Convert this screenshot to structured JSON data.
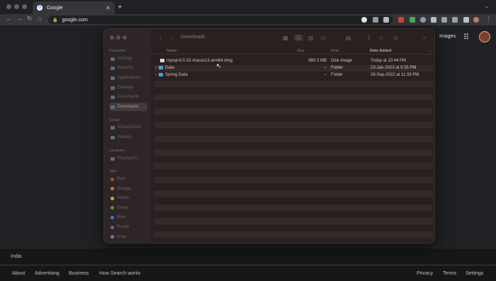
{
  "browser": {
    "tab_title": "Google",
    "tab_close": "✕",
    "new_tab": "+",
    "tab_menu": "⌄",
    "url": "google.com",
    "nav_back": "←",
    "nav_forward": "→",
    "nav_reload": "↻",
    "nav_home": "⌂",
    "lock": "🔒",
    "menu": "⋮"
  },
  "google": {
    "images_link": "Images",
    "apps_icon": "⋮⋮⋮",
    "country": "India",
    "footer_left": [
      "About",
      "Advertising",
      "Business",
      "How Search works"
    ],
    "footer_right": [
      "Privacy",
      "Terms",
      "Settings"
    ]
  },
  "finder": {
    "title": "Downloads",
    "back": "‹",
    "forward": "›",
    "sidebar": {
      "favourites_header": "Favourites",
      "favourites": [
        "AirDrop",
        "Recents",
        "Applications",
        "Desktop",
        "Documents",
        "Downloads"
      ],
      "icloud_header": "iCloud",
      "icloud": [
        "iCloud Drive",
        "Shared"
      ],
      "locations_header": "Locations",
      "locations": [
        "Prashant's..."
      ],
      "tags_header": "Tags",
      "tags": [
        {
          "label": "Red",
          "color": "#b9443e"
        },
        {
          "label": "Orange",
          "color": "#c77a2b"
        },
        {
          "label": "Yellow",
          "color": "#c8ad34"
        },
        {
          "label": "Green",
          "color": "#4d9a48"
        },
        {
          "label": "Blue",
          "color": "#3d78c2"
        },
        {
          "label": "Purple",
          "color": "#8a55a8"
        },
        {
          "label": "Gray",
          "color": "#7d7d7d"
        }
      ]
    },
    "columns": {
      "name": "Name",
      "size": "Size",
      "kind": "Kind",
      "date": "Date Added"
    },
    "files": [
      {
        "name": "mysql-8.0.32-macos13-arm64.dmg",
        "size": "580.3 MB",
        "kind": "Disk Image",
        "date": "Today at 10:44 PM",
        "type": "file"
      },
      {
        "name": "Data",
        "size": "--",
        "kind": "Folder",
        "date": "23-Jan-2023 at 9:35 PM",
        "type": "folder"
      },
      {
        "name": "Spring Data",
        "size": "--",
        "kind": "Folder",
        "date": "28-Sep-2022 at 11:33 PM",
        "type": "folder"
      }
    ]
  }
}
